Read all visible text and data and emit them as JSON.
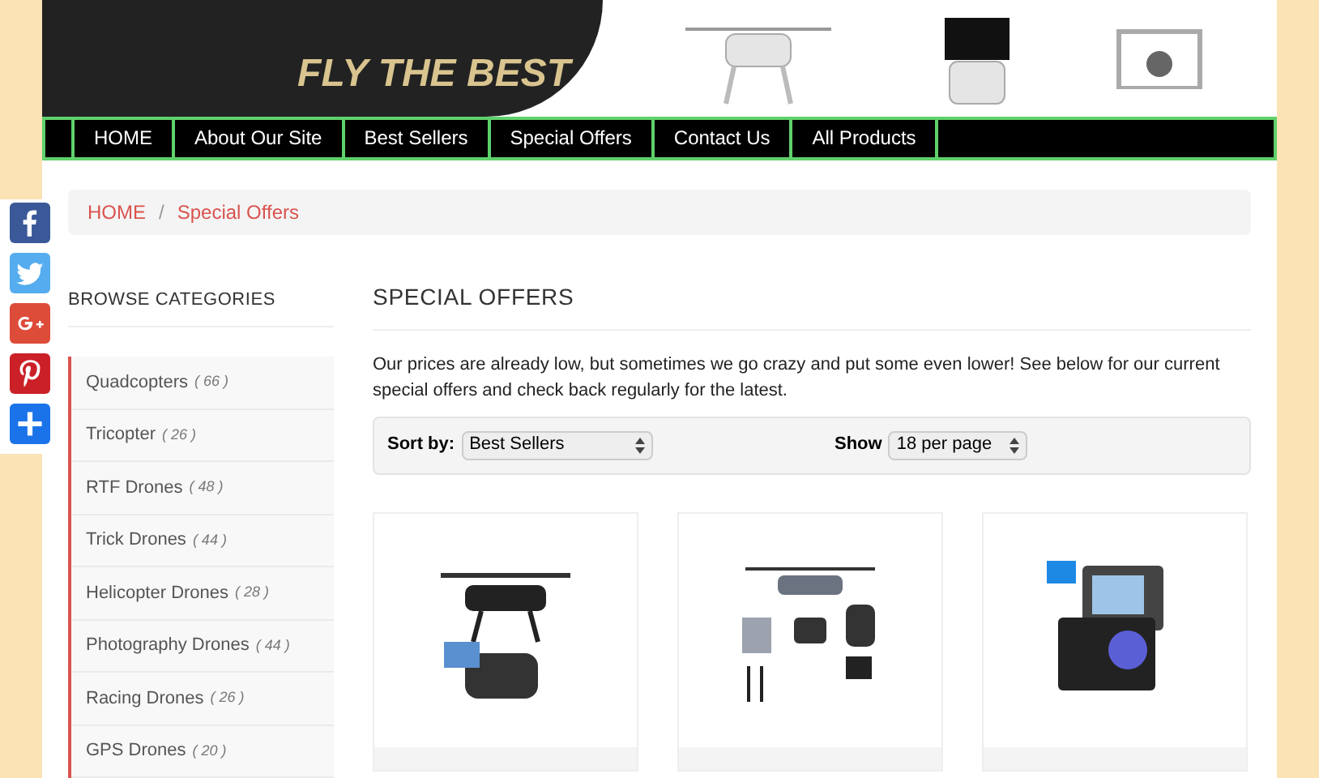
{
  "banner": {
    "slogan": "FLY THE BEST"
  },
  "nav": [
    {
      "label": "HOME",
      "selected": false
    },
    {
      "label": "About Our Site",
      "selected": false
    },
    {
      "label": "Best Sellers",
      "selected": false
    },
    {
      "label": "Special Offers",
      "selected": false
    },
    {
      "label": "Contact Us",
      "selected": false
    },
    {
      "label": "All Products",
      "selected": false
    }
  ],
  "social": [
    {
      "kind": "facebook",
      "color": "#3b5998"
    },
    {
      "kind": "twitter",
      "color": "#55acee"
    },
    {
      "kind": "googleplus",
      "color": "#dd4b39"
    },
    {
      "kind": "pinterest",
      "color": "#cb2027"
    },
    {
      "kind": "share",
      "color": "#1a73e8"
    }
  ],
  "breadcrumb": [
    "HOME",
    "Special Offers"
  ],
  "breadcrumb_separator": "/",
  "sidebar": {
    "title": "BROWSE CATEGORIES",
    "items": [
      {
        "label": "Quadcopters",
        "count": "( 66 )"
      },
      {
        "label": "Tricopter",
        "count": "( 26 )"
      },
      {
        "label": "RTF Drones",
        "count": "( 48 )"
      },
      {
        "label": "Trick Drones",
        "count": "( 44 )"
      },
      {
        "label": "Helicopter Drones",
        "count": "( 28 )"
      },
      {
        "label": "Photography Drones",
        "count": "( 44 )"
      },
      {
        "label": "Racing Drones",
        "count": "( 26 )"
      },
      {
        "label": "GPS Drones",
        "count": "( 20 )"
      }
    ]
  },
  "main": {
    "title": "SPECIAL OFFERS",
    "intro": "Our prices are already low, but sometimes we go crazy and put some even lower! See below for our current special offers and check back regularly for the latest.",
    "sort": {
      "label": "Sort by:",
      "value": "Best Sellers"
    },
    "show": {
      "label": "Show",
      "value": "18 per page"
    },
    "products": [
      {
        "kind": "drone"
      },
      {
        "kind": "kit"
      },
      {
        "kind": "camera"
      }
    ]
  }
}
